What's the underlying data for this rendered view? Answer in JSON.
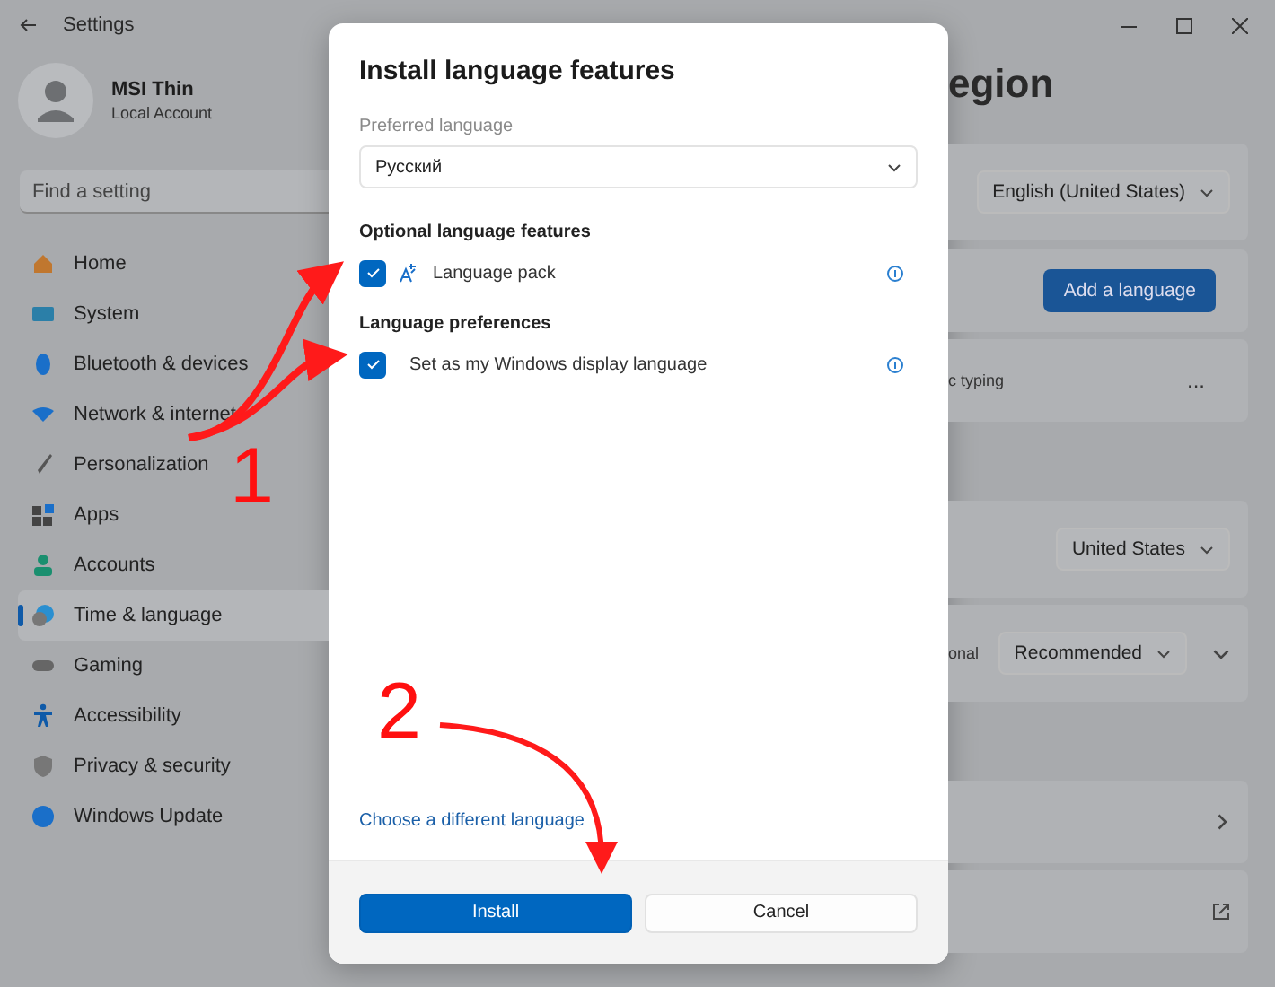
{
  "window": {
    "title": "Settings"
  },
  "sidebar": {
    "profile": {
      "name": "MSI Thin",
      "account": "Local Account"
    },
    "search": {
      "placeholder": "Find a setting"
    },
    "items": [
      {
        "label": "Home",
        "selected": false
      },
      {
        "label": "System",
        "selected": false
      },
      {
        "label": "Bluetooth & devices",
        "selected": false
      },
      {
        "label": "Network & internet",
        "selected": false
      },
      {
        "label": "Personalization",
        "selected": false
      },
      {
        "label": "Apps",
        "selected": false
      },
      {
        "label": "Accounts",
        "selected": false
      },
      {
        "label": "Time & language",
        "selected": true
      },
      {
        "label": "Gaming",
        "selected": false
      },
      {
        "label": "Accessibility",
        "selected": false
      },
      {
        "label": "Privacy & security",
        "selected": false
      },
      {
        "label": "Windows Update",
        "selected": false
      }
    ]
  },
  "page": {
    "title": "egion",
    "cards": [
      {
        "kind": "dropdown",
        "value": "English (United States)"
      },
      {
        "kind": "button",
        "label": "Add a language"
      },
      {
        "kind": "more",
        "text": "c typing",
        "action": "..."
      },
      {
        "kind": "dropdown",
        "value": "United States"
      },
      {
        "kind": "dropdown-expand",
        "text": "onal",
        "value": "Recommended"
      },
      {
        "kind": "chevron"
      },
      {
        "kind": "external"
      }
    ]
  },
  "dialog": {
    "title": "Install language features",
    "select_label": "Preferred language",
    "select_value": "Русский",
    "sections": [
      {
        "heading": "Optional language features",
        "items": [
          {
            "kind": "feature",
            "label": "Language pack",
            "checked": true
          }
        ]
      },
      {
        "heading": "Language preferences",
        "items": [
          {
            "kind": "preference",
            "label": "Set as my Windows display language",
            "checked": true
          }
        ]
      }
    ],
    "link": "Choose a different language",
    "buttons": [
      {
        "label": "Install",
        "primary": true
      },
      {
        "label": "Cancel",
        "primary": false
      }
    ]
  },
  "annotations": [
    {
      "label": "1"
    },
    {
      "label": "2"
    }
  ]
}
